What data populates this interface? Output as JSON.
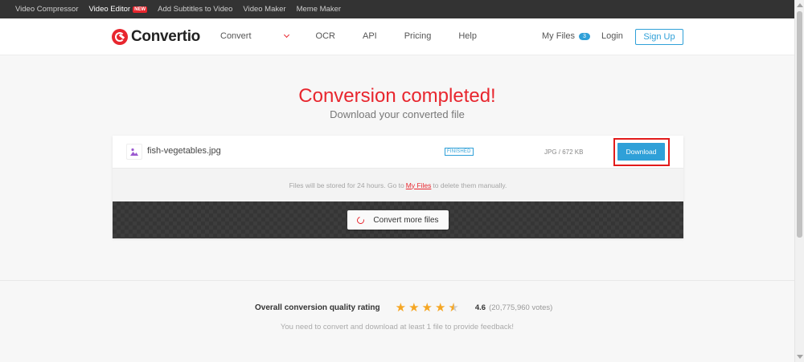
{
  "topbar": {
    "links": [
      "Video Compressor",
      "Video Editor",
      "Add Subtitles to Video",
      "Video Maker",
      "Meme Maker"
    ],
    "new_badge": "NEW"
  },
  "header": {
    "logo": "Convertio",
    "nav": [
      "Convert",
      "OCR",
      "API",
      "Pricing",
      "Help"
    ],
    "my_files": "My Files",
    "my_files_count": "3",
    "login": "Login",
    "signup": "Sign Up"
  },
  "main": {
    "title": "Conversion completed!",
    "subtitle": "Download your converted file",
    "file": {
      "name": "fish-vegetables.jpg",
      "status": "FINISHED",
      "size": "JPG / 672 KB",
      "download_label": "Download"
    },
    "storage_note_before": "Files will be stored for 24 hours. Go to",
    "storage_note_link": "My Files",
    "storage_note_after": "to delete them manually.",
    "convert_more": "Convert more files"
  },
  "rating": {
    "label": "Overall conversion quality rating",
    "score": "4.6",
    "value": 4.6,
    "max": 5,
    "votes": "(20,775,960 votes)",
    "feedback": "You need to convert and download at least 1 file to provide feedback!"
  },
  "colors": {
    "brand_red": "#e8262e",
    "accent_blue": "#2fa0d8",
    "star": "#f5a623"
  }
}
